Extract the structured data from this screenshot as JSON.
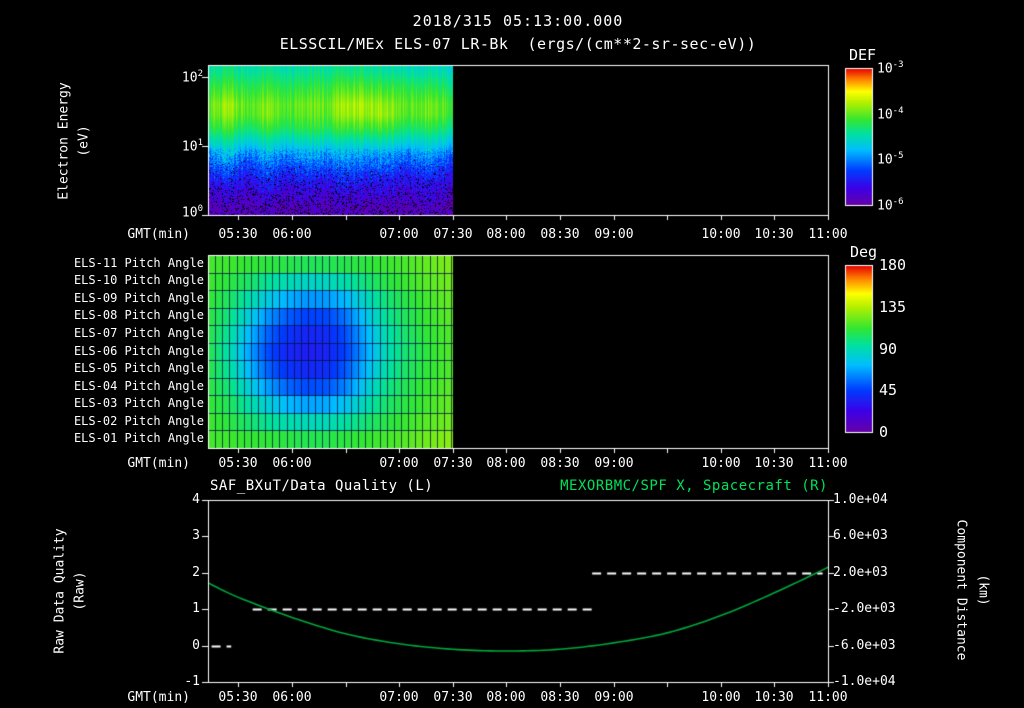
{
  "colors": {
    "background": "#000000",
    "text": "#ffffff",
    "accent_green": "#00e05a",
    "curve_green": "#00a83c",
    "axis": "#ffffff"
  },
  "header": {
    "timestamp": "2018/315 05:13:00.000",
    "title": "ELSSCIL/MEx ELS-07 LR-Bk  (ergs/(cm**2-sr-sec-eV))"
  },
  "x_axis": {
    "label": "GMT(min)",
    "range_min": [
      313,
      660
    ],
    "ticks": [
      {
        "label": "05:30",
        "min": 330
      },
      {
        "label": "06:00",
        "min": 360
      },
      {
        "label": "07:00",
        "min": 420
      },
      {
        "label": "07:30",
        "min": 450
      },
      {
        "label": "08:00",
        "min": 480
      },
      {
        "label": "08:30",
        "min": 510
      },
      {
        "label": "09:00",
        "min": 540
      },
      {
        "label": "10:00",
        "min": 600
      },
      {
        "label": "10:30",
        "min": 630
      },
      {
        "label": "11:00",
        "min": 660
      }
    ],
    "minor_tick_mins": [
      330,
      360,
      390,
      420,
      450,
      480,
      510,
      540,
      570,
      600,
      630,
      660
    ]
  },
  "energy_panel": {
    "y_label": [
      "Electron Energy",
      "(eV)"
    ],
    "y_ticks": [
      {
        "base": "10",
        "exp": "2"
      },
      {
        "base": "10",
        "exp": "1"
      },
      {
        "base": "10",
        "exp": "0"
      }
    ]
  },
  "pitch_panel": {
    "row_labels": [
      "ELS-11 Pitch Angle",
      "ELS-10 Pitch Angle",
      "ELS-09 Pitch Angle",
      "ELS-08 Pitch Angle",
      "ELS-07 Pitch Angle",
      "ELS-06 Pitch Angle",
      "ELS-05 Pitch Angle",
      "ELS-04 Pitch Angle",
      "ELS-03 Pitch Angle",
      "ELS-02 Pitch Angle",
      "ELS-01 Pitch Angle"
    ]
  },
  "bottom_panel": {
    "title_left": "SAF_BXuT/Data Quality (L)",
    "title_right": "MEXORBMC/SPF X, Spacecraft (R)",
    "y_left_label": [
      "Raw Data Quality",
      "(Raw)"
    ],
    "y_left_ticks": [
      "4",
      "3",
      "2",
      "1",
      "0",
      "-1"
    ],
    "y_right_label": [
      "Component Distance",
      "(km)"
    ],
    "y_right_ticks": [
      "1.0e+04",
      "6.0e+03",
      "2.0e+03",
      "-2.0e+03",
      "-6.0e+03",
      "-1.0e+04"
    ]
  },
  "colorbars": {
    "def": {
      "title": "DEF",
      "tick_labels": [
        {
          "base": "10",
          "exp": "-3"
        },
        {
          "base": "10",
          "exp": "-4"
        },
        {
          "base": "10",
          "exp": "-5"
        },
        {
          "base": "10",
          "exp": "-6"
        }
      ]
    },
    "deg": {
      "title": "Deg",
      "tick_labels": [
        "180",
        "135",
        "90",
        "45",
        "0"
      ]
    }
  },
  "chart_data": [
    {
      "type": "heatmap",
      "name": "electron_energy_spectrogram",
      "title": "ELSSCIL/MEx ELS-07 LR-Bk",
      "units": "ergs/(cm**2-sr-sec-eV)",
      "x_range_min": [
        313,
        660
      ],
      "data_end_min": 450,
      "y_axis": {
        "label": "Electron Energy (eV)",
        "scale": "log",
        "range": [
          1,
          148
        ]
      },
      "value_log10_range": [
        -6,
        -3
      ],
      "colorbar": {
        "title": "DEF",
        "ticks_log10": [
          -3,
          -4,
          -5,
          -6
        ]
      },
      "colormap": "rainbow",
      "colormap_stops": [
        [
          0.0,
          100,
          0,
          170
        ],
        [
          0.12,
          60,
          0,
          230
        ],
        [
          0.25,
          0,
          60,
          255
        ],
        [
          0.4,
          0,
          190,
          255
        ],
        [
          0.52,
          0,
          225,
          160
        ],
        [
          0.62,
          50,
          230,
          50
        ],
        [
          0.75,
          180,
          240,
          0
        ],
        [
          0.83,
          255,
          255,
          0
        ],
        [
          0.92,
          255,
          130,
          0
        ],
        [
          1.0,
          230,
          0,
          0
        ]
      ],
      "energy_bins_log10": [
        0.1,
        0.35,
        0.6,
        0.85,
        1.05,
        1.25,
        1.45,
        1.6,
        1.85,
        2.1
      ],
      "time_cols_min": [
        313,
        324,
        335,
        346,
        357,
        368,
        379,
        390,
        401,
        412,
        423,
        434,
        450
      ],
      "values_log10": [
        [
          -5.9,
          -5.85,
          -5.9,
          -5.8,
          -5.9,
          -5.85,
          -5.9,
          -5.8,
          -5.9,
          -5.85,
          -5.9,
          -5.8,
          -5.9
        ],
        [
          -5.7,
          -5.6,
          -5.75,
          -5.55,
          -5.7,
          -5.6,
          -5.7,
          -5.55,
          -5.65,
          -5.6,
          -5.7,
          -5.6,
          -5.7
        ],
        [
          -5.4,
          -5.2,
          -5.5,
          -5.2,
          -5.45,
          -5.3,
          -5.4,
          -5.2,
          -5.35,
          -5.3,
          -5.45,
          -5.3,
          -5.5
        ],
        [
          -5.0,
          -4.8,
          -5.1,
          -4.85,
          -5.05,
          -4.9,
          -5.0,
          -4.85,
          -4.95,
          -4.9,
          -5.05,
          -4.9,
          -5.1
        ],
        [
          -4.6,
          -4.45,
          -4.7,
          -4.5,
          -4.65,
          -4.55,
          -4.6,
          -4.5,
          -4.55,
          -4.5,
          -4.65,
          -4.55,
          -4.7
        ],
        [
          -4.25,
          -4.1,
          -4.35,
          -4.15,
          -4.3,
          -4.2,
          -4.25,
          -4.1,
          -4.15,
          -4.1,
          -4.3,
          -4.2,
          -4.35
        ],
        [
          -4.05,
          -3.85,
          -4.1,
          -3.9,
          -4.1,
          -4.0,
          -4.05,
          -3.8,
          -3.85,
          -3.8,
          -4.05,
          -3.95,
          -4.1
        ],
        [
          -4.0,
          -3.8,
          -4.05,
          -3.9,
          -4.05,
          -3.95,
          -4.0,
          -3.75,
          -3.8,
          -3.85,
          -4.0,
          -3.95,
          -4.05
        ],
        [
          -4.2,
          -4.1,
          -4.25,
          -4.15,
          -4.25,
          -4.2,
          -4.2,
          -4.05,
          -4.1,
          -4.15,
          -4.2,
          -4.2,
          -4.3
        ],
        [
          -4.45,
          -4.35,
          -4.5,
          -4.4,
          -4.5,
          -4.45,
          -4.45,
          -4.35,
          -4.4,
          -4.45,
          -4.5,
          -4.5,
          -4.55
        ]
      ]
    },
    {
      "type": "heatmap",
      "name": "pitch_angle_panels",
      "rows_top_to_bottom": [
        "ELS-11",
        "ELS-10",
        "ELS-09",
        "ELS-08",
        "ELS-07",
        "ELS-06",
        "ELS-05",
        "ELS-04",
        "ELS-03",
        "ELS-02",
        "ELS-01"
      ],
      "x_range_min": [
        313,
        660
      ],
      "data_end_min": 450,
      "value_range_deg": [
        0,
        180
      ],
      "colorbar": {
        "title": "Deg",
        "ticks": [
          180,
          135,
          90,
          45,
          0
        ]
      },
      "grid_minutes": 4,
      "time_cols_min": [
        313,
        324,
        335,
        346,
        357,
        368,
        379,
        390,
        401,
        412,
        423,
        434,
        450
      ],
      "values_deg": [
        [
          115,
          114,
          112,
          110,
          108,
          106,
          106,
          108,
          110,
          113,
          116,
          120,
          126
        ],
        [
          114,
          110,
          104,
          96,
          90,
          86,
          87,
          92,
          100,
          108,
          113,
          118,
          124
        ],
        [
          112,
          105,
          93,
          80,
          70,
          64,
          65,
          72,
          86,
          100,
          108,
          114,
          122
        ],
        [
          110,
          100,
          83,
          64,
          52,
          46,
          47,
          57,
          76,
          95,
          105,
          112,
          120
        ],
        [
          109,
          96,
          74,
          54,
          42,
          36,
          38,
          49,
          69,
          90,
          102,
          110,
          118
        ],
        [
          108,
          93,
          69,
          49,
          37,
          33,
          35,
          46,
          66,
          88,
          101,
          109,
          118
        ],
        [
          109,
          96,
          74,
          54,
          42,
          37,
          39,
          51,
          71,
          91,
          103,
          110,
          118
        ],
        [
          110,
          101,
          84,
          66,
          54,
          48,
          50,
          60,
          79,
          97,
          106,
          112,
          120
        ],
        [
          112,
          106,
          94,
          82,
          72,
          67,
          68,
          76,
          89,
          102,
          109,
          114,
          122
        ],
        [
          114,
          110,
          103,
          96,
          91,
          89,
          89,
          94,
          101,
          108,
          113,
          118,
          124
        ],
        [
          115,
          114,
          112,
          111,
          109,
          107,
          107,
          110,
          112,
          115,
          118,
          122,
          128
        ]
      ]
    },
    {
      "type": "line",
      "name": "data_quality_and_spacecraft_x",
      "x_range_min": [
        313,
        660
      ],
      "left_axis": {
        "label": "Raw Data Quality (Raw)",
        "range": [
          -1,
          4
        ]
      },
      "right_axis": {
        "label": "Component Distance (km)",
        "range": [
          -10000,
          10000
        ]
      },
      "series": [
        {
          "name": "SAF_BXuT/Data Quality (L)",
          "axis": "left",
          "style": "dashed",
          "color": "#ffffff",
          "segments": [
            {
              "value": 0,
              "start_min": 315,
              "end_min": 326
            },
            {
              "value": 1,
              "start_min": 338,
              "end_min": 528
            },
            {
              "value": 2,
              "start_min": 528,
              "end_min": 657
            }
          ]
        },
        {
          "name": "MEXORBMC/SPF X, Spacecraft (R)",
          "axis": "right",
          "style": "solid",
          "color": "#00a83c",
          "x_min": [
            313,
            330,
            360,
            390,
            420,
            450,
            480,
            510,
            540,
            570,
            600,
            630,
            660
          ],
          "y_km": [
            900,
            -700,
            -2900,
            -4700,
            -5800,
            -6400,
            -6600,
            -6400,
            -5700,
            -4600,
            -2700,
            -200,
            2600
          ]
        }
      ]
    }
  ]
}
